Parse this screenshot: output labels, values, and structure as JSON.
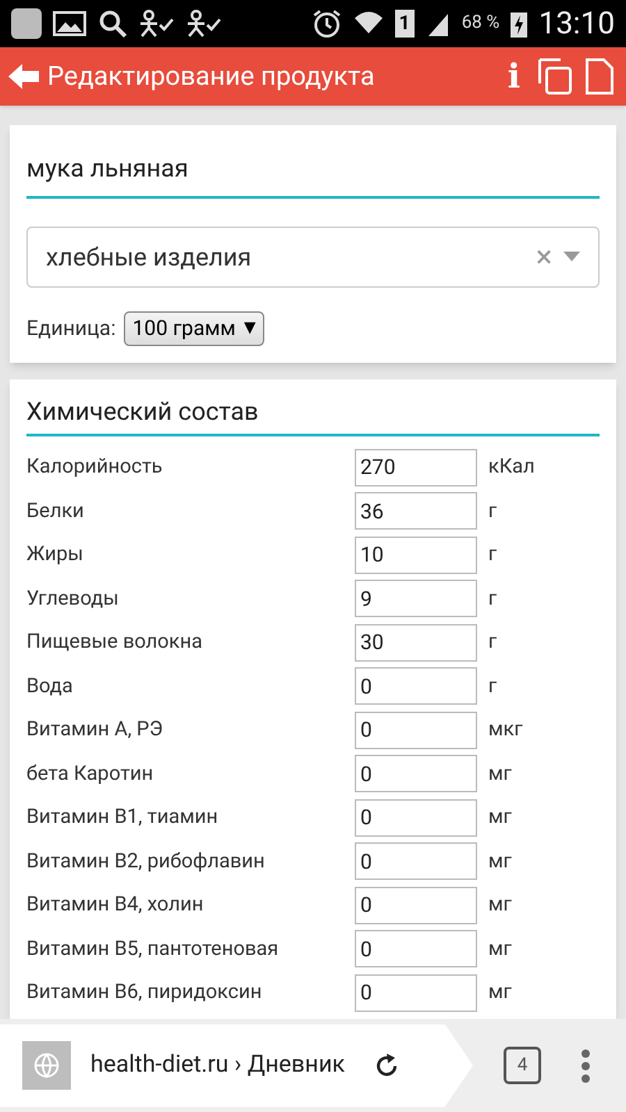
{
  "status_bar": {
    "sim": "1",
    "battery": "68 %",
    "time": "13:10"
  },
  "app_bar": {
    "title": "Редактирование продукта",
    "info": "i"
  },
  "product": {
    "name": "мука льняная",
    "category": "хлебные изделия",
    "clear": "×",
    "unit_label": "Единица:",
    "unit": "100 грамм",
    "unit_caret": "▼"
  },
  "composition": {
    "title": "Химический состав",
    "rows": [
      {
        "label": "Калорийность",
        "value": "270",
        "unit": "кКал"
      },
      {
        "label": "Белки",
        "value": "36",
        "unit": "г"
      },
      {
        "label": "Жиры",
        "value": "10",
        "unit": "г"
      },
      {
        "label": "Углеводы",
        "value": "9",
        "unit": "г"
      },
      {
        "label": "Пищевые волокна",
        "value": "30",
        "unit": "г"
      },
      {
        "label": "Вода",
        "value": "0",
        "unit": "г"
      },
      {
        "label": "Витамин А, РЭ",
        "value": "0",
        "unit": "мкг"
      },
      {
        "label": "бета Каротин",
        "value": "0",
        "unit": "мг"
      },
      {
        "label": "Витамин В1, тиамин",
        "value": "0",
        "unit": "мг"
      },
      {
        "label": "Витамин В2, рибофлавин",
        "value": "0",
        "unit": "мг"
      },
      {
        "label": "Витамин В4, холин",
        "value": "0",
        "unit": "мг"
      },
      {
        "label": "Витамин В5, пантотеновая",
        "value": "0",
        "unit": "мг"
      },
      {
        "label": "Витамин В6, пиридоксин",
        "value": "0",
        "unit": "мг"
      }
    ]
  },
  "browser_bar": {
    "url": "health-diet.ru › Дневник",
    "tabs": "4"
  }
}
